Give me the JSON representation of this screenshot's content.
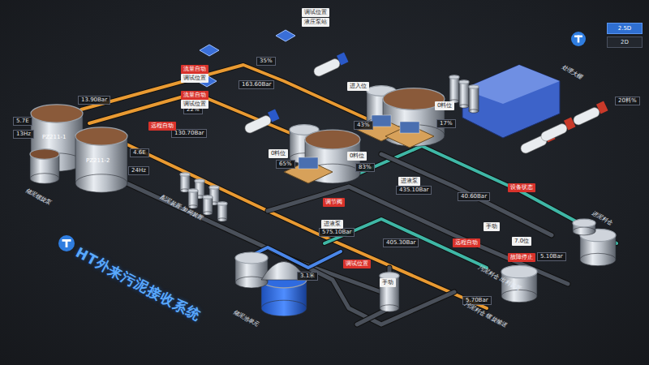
{
  "view_toggle": [
    {
      "label": "2.5D",
      "selected": true
    },
    {
      "label": "2D",
      "selected": false
    }
  ],
  "title": "HT外来污泥接收系统",
  "tanks": [
    {
      "name": "PZ211-1"
    },
    {
      "name": "PZ211-2"
    }
  ],
  "readings": [
    "5.7E",
    "13Hz",
    "13.90Bar",
    "4.6E",
    "24Hz",
    "35%",
    "163.60Bar",
    "22%",
    "130.70Bar",
    "43%",
    "65%",
    "83%",
    "17%",
    "435.10Bar",
    "40.60Bar",
    "575.10Bar",
    "405.30Bar",
    "5.10Bar",
    "5.70Bar",
    "3.1米",
    "20料%"
  ],
  "status_tags": [
    {
      "label": "调试位置",
      "kind": "normal"
    },
    {
      "label": "液压泵站",
      "kind": "normal"
    },
    {
      "label": "流量自动",
      "kind": "alarm"
    },
    {
      "label": "调试位置",
      "kind": "normal"
    },
    {
      "label": "流量自动",
      "kind": "alarm"
    },
    {
      "label": "调试位置",
      "kind": "normal"
    },
    {
      "label": "远程自动",
      "kind": "alarm"
    },
    {
      "label": "进入位",
      "kind": "normal"
    },
    {
      "label": "0料位",
      "kind": "normal"
    },
    {
      "label": "0料位",
      "kind": "normal"
    },
    {
      "label": "0料位",
      "kind": "normal"
    },
    {
      "label": "进液泵",
      "kind": "normal"
    },
    {
      "label": "调节阀",
      "kind": "alarm"
    },
    {
      "label": "进液泵",
      "kind": "normal"
    },
    {
      "label": "设备状态",
      "kind": "alarm"
    },
    {
      "label": "手动",
      "kind": "normal"
    },
    {
      "label": "远程自动",
      "kind": "alarm"
    },
    {
      "label": "7.0位",
      "kind": "normal"
    },
    {
      "label": "故障停止",
      "kind": "alarm"
    },
    {
      "label": "调试位置",
      "kind": "alarm"
    },
    {
      "label": "手动",
      "kind": "normal"
    }
  ],
  "vertical_labels": [
    "储泥螺旋泵",
    "配泥装置 加药装置",
    "储泥池单元",
    "处理大棚",
    "进泥料仓",
    "污泥料仓 出料装置",
    "污泥料仓 螺旋输送"
  ]
}
